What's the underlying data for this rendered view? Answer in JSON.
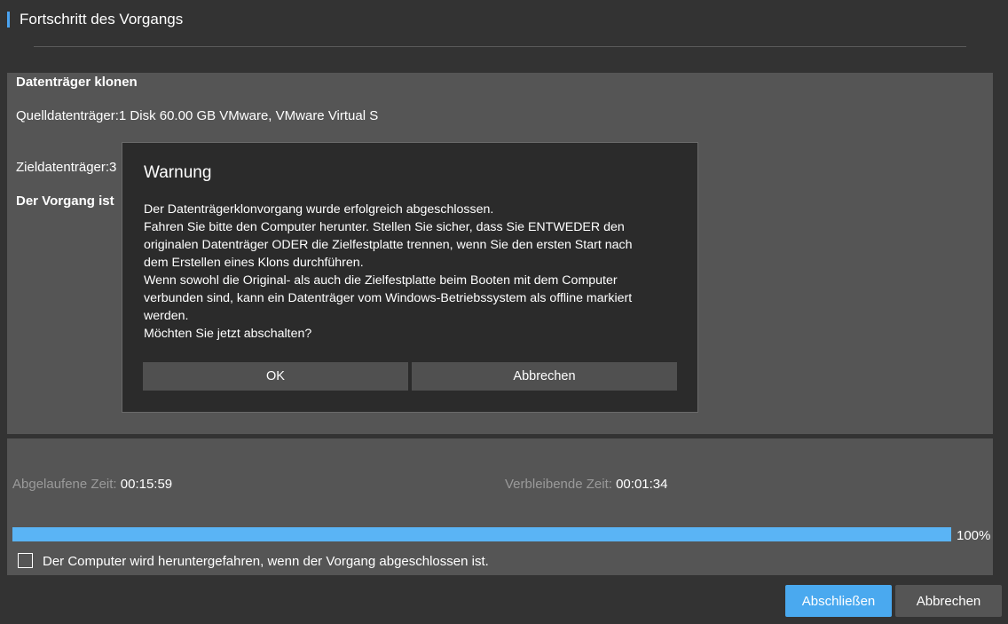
{
  "header": {
    "title": "Fortschritt des Vorgangs"
  },
  "info": {
    "operation_title": "Datenträger klonen",
    "source_label": "Quelldatenträger:1 Disk 60.00 GB VMware, VMware Virtual S",
    "target_label": "Zieldatenträger:3",
    "status_label": "Der Vorgang ist"
  },
  "dialog": {
    "title": "Warnung",
    "lines": [
      "Der Datenträgerklonvorgang wurde erfolgreich abgeschlossen.",
      "Fahren Sie bitte den Computer herunter. Stellen Sie sicher, dass Sie ENTWEDER den",
      "originalen Datenträger ODER die Zielfestplatte trennen, wenn Sie den ersten Start nach",
      "dem Erstellen eines Klons durchführen.",
      "Wenn sowohl die Original- als auch die Zielfestplatte beim Booten mit dem Computer",
      "verbunden sind, kann ein Datenträger vom Windows-Betriebssystem als offline markiert",
      "werden.",
      "Möchten Sie jetzt abschalten?"
    ],
    "ok_label": "OK",
    "cancel_label": "Abbrechen"
  },
  "progress": {
    "elapsed_label": "Abgelaufene Zeit:",
    "elapsed_value": "00:15:59",
    "remaining_label": "Verbleibende Zeit:",
    "remaining_value": "00:01:34",
    "percent": 100,
    "percent_text": "100%",
    "shutdown_checkbox_label": "Der Computer wird heruntergefahren, wenn der Vorgang abgeschlossen ist.",
    "shutdown_checked": false
  },
  "footer": {
    "finish_label": "Abschließen",
    "cancel_label": "Abbrechen"
  },
  "colors": {
    "accent": "#4aa9ef",
    "progress_fill": "#5ab4f5"
  }
}
